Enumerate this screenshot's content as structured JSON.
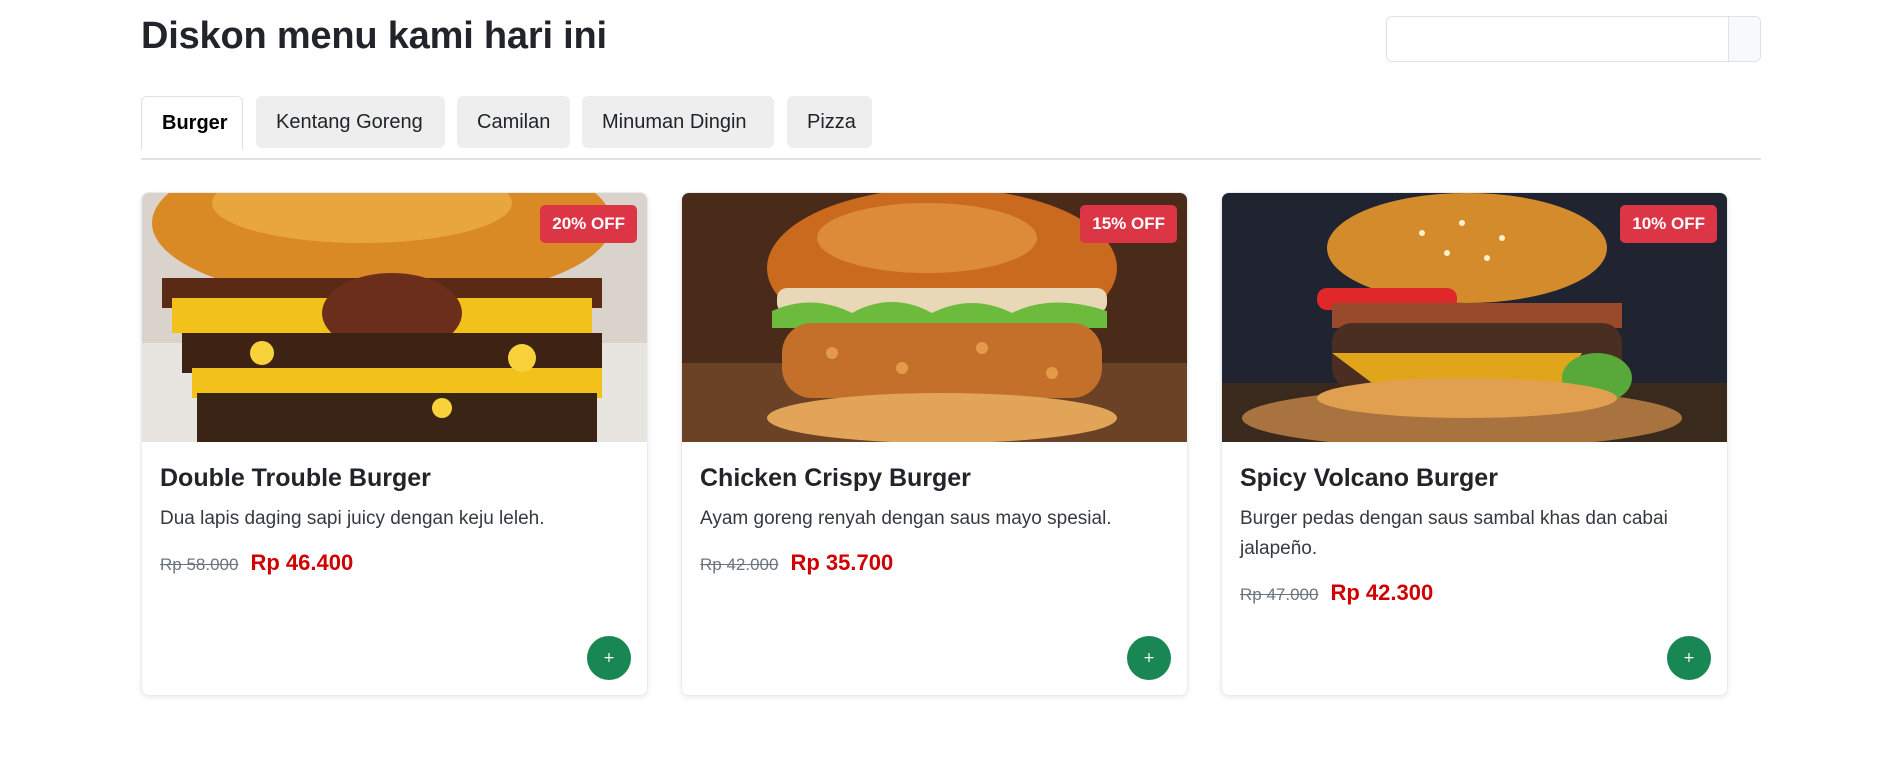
{
  "header": {
    "title": "Diskon menu kami hari ini",
    "search": {
      "value": "",
      "placeholder": ""
    }
  },
  "tabs": [
    {
      "label": "Burger",
      "active": true
    },
    {
      "label": "Kentang Goreng",
      "active": false
    },
    {
      "label": "Camilan",
      "active": false
    },
    {
      "label": "Minuman Dingin",
      "active": false
    },
    {
      "label": "Pizza",
      "active": false
    }
  ],
  "products": [
    {
      "name": "Double Trouble Burger",
      "description": "Dua lapis daging sapi juicy dengan keju leleh.",
      "discount": "20% OFF",
      "old_price": "Rp 58.000",
      "new_price": "Rp 46.400",
      "add_label": "+",
      "image_icon": "double-patty-cheeseburger"
    },
    {
      "name": "Chicken Crispy Burger",
      "description": "Ayam goreng renyah dengan saus mayo spesial.",
      "discount": "15% OFF",
      "old_price": "Rp 42.000",
      "new_price": "Rp 35.700",
      "add_label": "+",
      "image_icon": "crispy-chicken-burger"
    },
    {
      "name": "Spicy Volcano Burger",
      "description": "Burger pedas dengan saus sambal khas dan cabai jalapeño.",
      "discount": "10% OFF",
      "old_price": "Rp 47.000",
      "new_price": "Rp 42.300",
      "add_label": "+",
      "image_icon": "spicy-beef-burger"
    }
  ],
  "colors": {
    "discount_badge": "#dc3545",
    "new_price": "#d00000",
    "add_button": "#198754",
    "inactive_tab": "#eeeeee"
  }
}
